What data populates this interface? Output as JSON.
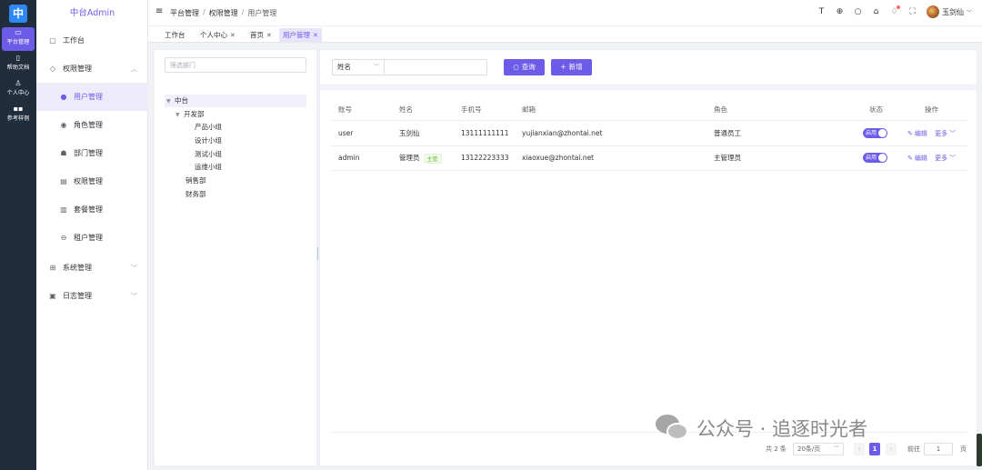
{
  "rail": {
    "items": [
      {
        "icon": "monitor-icon",
        "label": "平台管理"
      },
      {
        "icon": "book-icon",
        "label": "帮助文档"
      },
      {
        "icon": "user-icon",
        "label": "个人中心"
      },
      {
        "icon": "grid-icon",
        "label": "参考样例"
      }
    ]
  },
  "menu": {
    "title": "中台Admin",
    "items": [
      {
        "label": "工作台"
      },
      {
        "label": "权限管理"
      },
      {
        "label": "用户管理"
      },
      {
        "label": "角色管理"
      },
      {
        "label": "部门管理"
      },
      {
        "label": "权限管理"
      },
      {
        "label": "套餐管理"
      },
      {
        "label": "租户管理"
      },
      {
        "label": "系统管理"
      },
      {
        "label": "日志管理"
      }
    ]
  },
  "header": {
    "breadcrumb": [
      "平台管理",
      "权限管理",
      "用户管理"
    ],
    "user_name": "玉剑仙"
  },
  "tags": [
    {
      "label": "工作台"
    },
    {
      "label": "个人中心"
    },
    {
      "label": "首页"
    },
    {
      "label": "用户管理"
    }
  ],
  "tree": {
    "filter_placeholder": "筛选部门",
    "nodes": [
      {
        "label": "中台"
      },
      {
        "label": "开发部"
      },
      {
        "label": "产品小组"
      },
      {
        "label": "设计小组"
      },
      {
        "label": "测试小组"
      },
      {
        "label": "运维小组"
      },
      {
        "label": "销售部"
      },
      {
        "label": "财务部"
      }
    ]
  },
  "search": {
    "field_select": "姓名",
    "input_value": "",
    "query_label": "查询",
    "add_label": "新增"
  },
  "table": {
    "columns": [
      "账号",
      "姓名",
      "手机号",
      "邮箱",
      "角色",
      "状态",
      "操作"
    ],
    "rows": [
      {
        "account": "user",
        "name": "玉剑仙",
        "tag": "",
        "phone": "13111111111",
        "email": "yujianxian@zhontai.net",
        "role": "普通员工",
        "status": "启用",
        "edit": "编辑",
        "more": "更多"
      },
      {
        "account": "admin",
        "name": "管理员",
        "tag": "主管",
        "phone": "13122223333",
        "email": "xiaoxue@zhontai.net",
        "role": "主管理员",
        "status": "启用",
        "edit": "编辑",
        "more": "更多"
      }
    ]
  },
  "pagination": {
    "total": "共 2 条",
    "page_size": "20条/页",
    "current_page": "1",
    "goto_label": "前往",
    "goto_value": "1",
    "page_unit": "页"
  },
  "watermark": {
    "text": "公众号 · 追逐时光者"
  },
  "colors": {
    "accent": "#6c5ce7",
    "rail_bg": "#1f2d3d",
    "tag_green": "#67c23a"
  }
}
